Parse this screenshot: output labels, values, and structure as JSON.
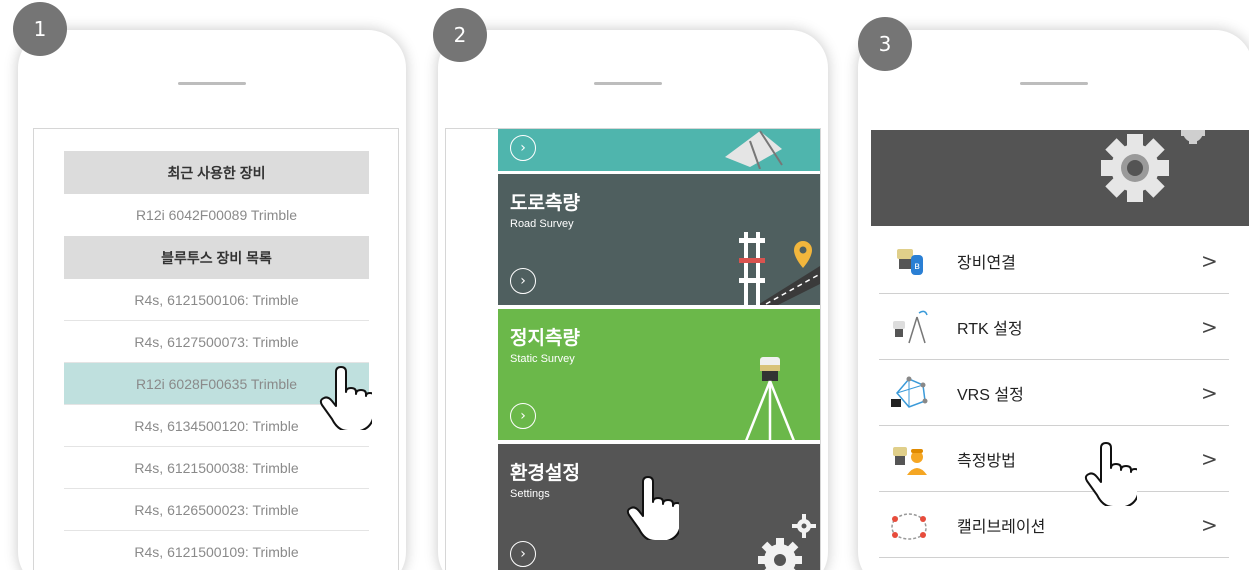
{
  "steps": [
    "1",
    "2",
    "3"
  ],
  "screen1": {
    "recent_header": "최근 사용한 장비",
    "recent_device": "R12i 6042F00089 Trimble",
    "bt_header": "블루투스 장비 목록",
    "devices": [
      "R4s, 6121500106: Trimble",
      "R4s, 6127500073: Trimble",
      "R12i 6028F00635 Trimble",
      "R4s, 6134500120: Trimble",
      "R4s, 6121500038: Trimble",
      "R4s, 6126500023: Trimble",
      "R4s, 6121500109: Trimble"
    ],
    "selected_device": "R12i 6028F00635 Trimble"
  },
  "screen2": {
    "tiles": [
      {
        "ko": "",
        "en": "",
        "color": "#4fb5ad"
      },
      {
        "ko": "도로측량",
        "en": "Road Survey",
        "color": "#4f5f5f"
      },
      {
        "ko": "정지측량",
        "en": "Static Survey",
        "color": "#6bb84a"
      },
      {
        "ko": "환경설정",
        "en": "Settings",
        "color": "#555555"
      }
    ]
  },
  "screen3": {
    "menu": [
      {
        "label": "장비연결",
        "icon": "receiver-bluetooth-icon"
      },
      {
        "label": "RTK 설정",
        "icon": "rtk-antenna-icon"
      },
      {
        "label": "VRS 설정",
        "icon": "vrs-network-icon"
      },
      {
        "label": "측정방법",
        "icon": "surveyor-icon"
      },
      {
        "label": "캘리브레이션",
        "icon": "calibration-icon"
      }
    ]
  },
  "colors": {
    "badge": "#757575",
    "selected_row": "#bfe0de",
    "header_gray": "#dcdcdc",
    "settings_dark": "#545454"
  }
}
